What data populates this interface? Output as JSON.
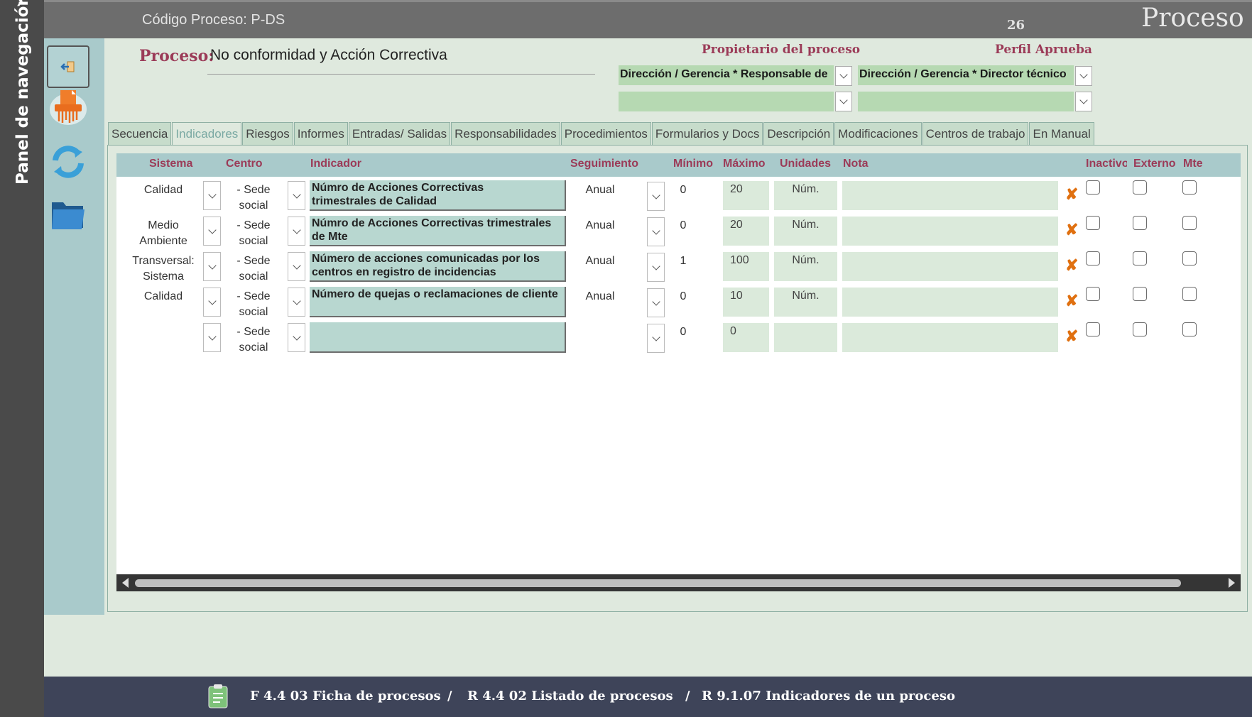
{
  "nav": {
    "label": "Panel de navegación"
  },
  "header": {
    "code_label": "Código Proceso: P-DS",
    "number": "26",
    "title": "Proceso"
  },
  "process": {
    "label": "Proceso:",
    "name": "No conformidad y Acción Correctiva",
    "owner_label": "Propietario del proceso",
    "approver_label": "Perfil Aprueba",
    "owner_value": "Dirección / Gerencia * Responsable de",
    "approver_value": "Dirección / Gerencia * Director técnico",
    "owner_value2": "",
    "approver_value2": ""
  },
  "tabs": [
    {
      "label": "Secuencia"
    },
    {
      "label": "Indicadores",
      "active": true
    },
    {
      "label": "Riesgos"
    },
    {
      "label": "Informes"
    },
    {
      "label": "Entradas/ Salidas"
    },
    {
      "label": "Responsabilidades"
    },
    {
      "label": "Procedimientos"
    },
    {
      "label": "Formularios y Docs"
    },
    {
      "label": "Descripción"
    },
    {
      "label": "Modificaciones"
    },
    {
      "label": "Centros de trabajo"
    },
    {
      "label": "En Manual"
    }
  ],
  "table": {
    "headers": {
      "sistema": "Sistema",
      "centro": "Centro",
      "indicador": "Indicador",
      "seguimiento": "Seguimiento",
      "minimo": "Mínimo",
      "maximo": "Máximo",
      "unidades": "Unidades",
      "nota": "Nota",
      "inactivo": "Inactivo",
      "externo": "Externo",
      "mte": "Mte"
    },
    "rows": [
      {
        "sistema": "Calidad",
        "centro": "- Sede social",
        "indicador": "Númro de Acciones Correctivas trimestrales de Calidad",
        "seguimiento": "Anual",
        "minimo": "0",
        "maximo": "20",
        "unidades": "Núm.",
        "nota": "",
        "inactivo": false,
        "externo": false,
        "mte": false
      },
      {
        "sistema": "Medio Ambiente",
        "centro": "- Sede social",
        "indicador": "Númro de Acciones Correctivas trimestrales de Mte",
        "seguimiento": "Anual",
        "minimo": "0",
        "maximo": "20",
        "unidades": "Núm.",
        "nota": "",
        "inactivo": false,
        "externo": false,
        "mte": false
      },
      {
        "sistema": "Transversal: Sistema",
        "centro": "- Sede social",
        "indicador": "Número de acciones comunicadas por los centros en registro de incidencias",
        "seguimiento": "Anual",
        "minimo": "1",
        "maximo": "100",
        "unidades": "Núm.",
        "nota": "",
        "inactivo": false,
        "externo": false,
        "mte": false
      },
      {
        "sistema": "Calidad",
        "centro": "- Sede social",
        "indicador": "Número de quejas o reclamaciones de cliente",
        "seguimiento": "Anual",
        "minimo": "0",
        "maximo": "10",
        "unidades": "Núm.",
        "nota": "",
        "inactivo": false,
        "externo": false,
        "mte": false
      },
      {
        "sistema": "",
        "centro": "- Sede social",
        "indicador": "",
        "seguimiento": "",
        "minimo": "0",
        "maximo": "0",
        "unidades": "",
        "nota": "",
        "inactivo": false,
        "externo": false,
        "mte": false
      }
    ]
  },
  "footer": {
    "link1": "F 4.4 03 Ficha de procesos",
    "sep": "/",
    "link2": "R 4.4 02 Listado de procesos",
    "link3": "R 9.1.07 Indicadores de un proceso"
  },
  "colors": {
    "accent": "#9b3b58",
    "delete": "#e07010",
    "nav_bg": "#4a4a4a",
    "footer_bg": "#3e4459"
  }
}
